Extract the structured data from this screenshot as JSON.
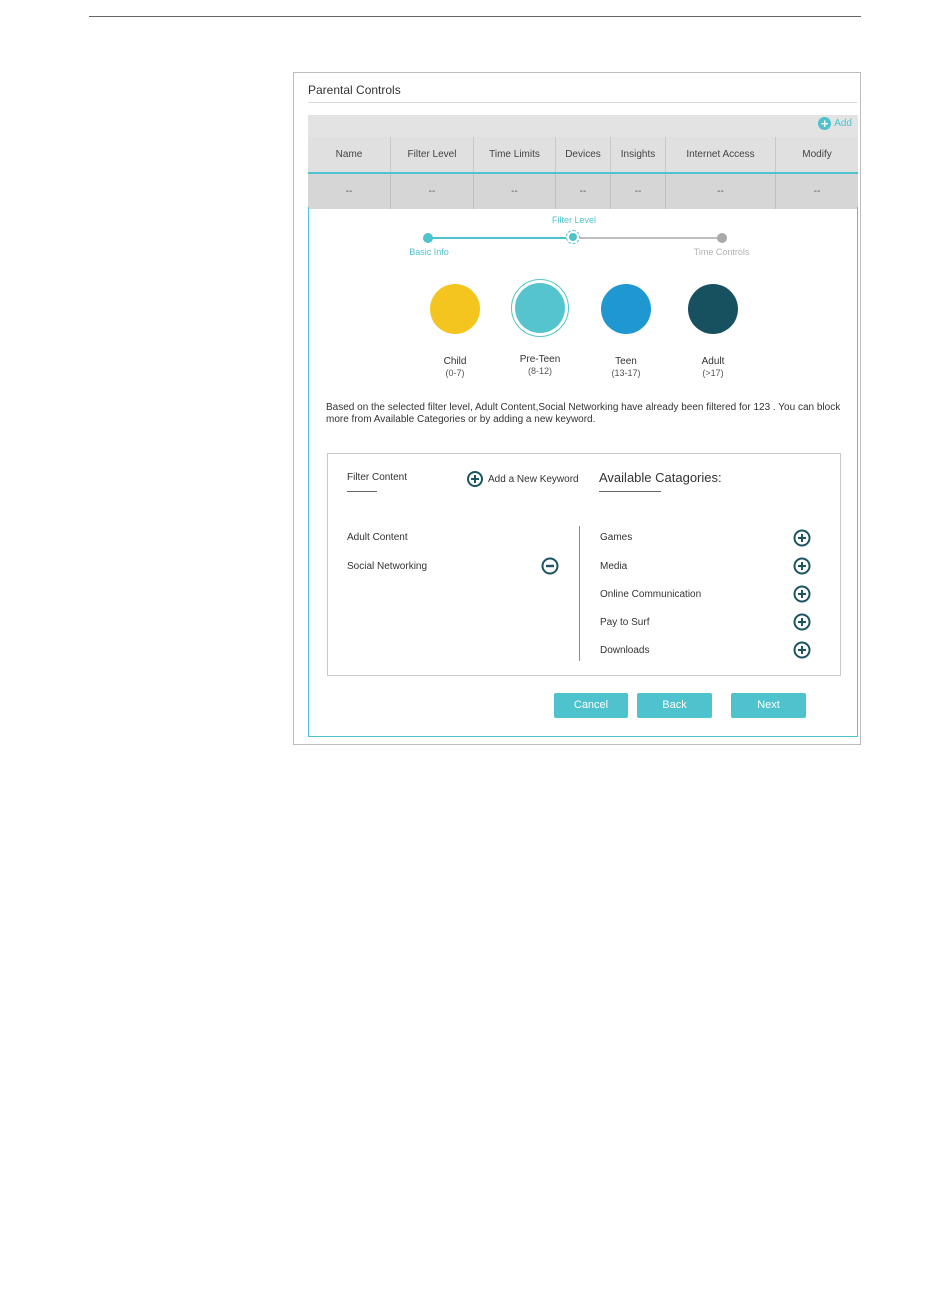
{
  "panel": {
    "title": "Parental Controls",
    "add_label": "Add"
  },
  "table": {
    "columns": [
      "Name",
      "Filter Level",
      "Time Limits",
      "Devices",
      "Insights",
      "Internet Access",
      "Modify"
    ],
    "row": [
      "--",
      "--",
      "--",
      "--",
      "--",
      "--",
      "--"
    ]
  },
  "wizard": {
    "steps": [
      "Basic Info",
      "Filter Level",
      "Time Controls"
    ],
    "current_step": "Filter Level"
  },
  "levels": [
    {
      "label": "Child",
      "range": "(0-7)",
      "color": "#f4c51f"
    },
    {
      "label": "Pre-Teen",
      "range": "(8-12)",
      "color": "#55c4ce",
      "selected": true
    },
    {
      "label": "Teen",
      "range": "(13-17)",
      "color": "#1f97d1"
    },
    {
      "label": "Adult",
      "range": "(>17)",
      "color": "#175160"
    }
  ],
  "description": "Based on the selected filter level, Adult Content,Social Networking have already been filtered for 123 . You can block more from Available Categories or by adding a new keyword.",
  "filter": {
    "title": "Filter Content",
    "add_keyword_label": "Add a New Keyword",
    "items": [
      "Adult Content",
      "Social Networking"
    ]
  },
  "available": {
    "title": "Available Catagories:",
    "items": [
      "Games",
      "Media",
      "Online Communication",
      "Pay to Surf",
      "Downloads"
    ]
  },
  "buttons": {
    "cancel": "Cancel",
    "back": "Back",
    "next": "Next"
  },
  "colors": {
    "accent": "#4ec2cd",
    "dark_icon": "#1a5560"
  }
}
